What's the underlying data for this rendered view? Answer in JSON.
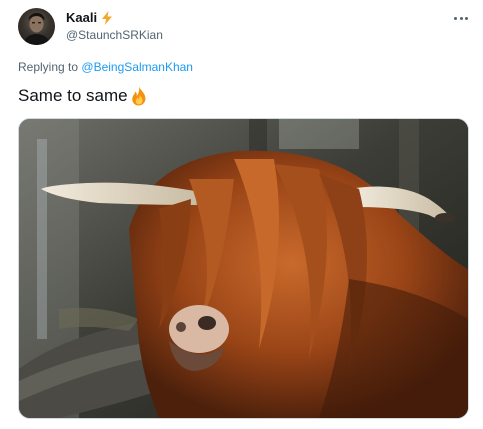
{
  "tweet": {
    "author": {
      "name": "Kaali",
      "handle": "@StaunchSRKian",
      "badge_icon": "lightning-bolt-icon",
      "badge_color": "#f5a623"
    },
    "reply": {
      "prefix": "Replying to",
      "target": "@BeingSalmanKhan",
      "link_color": "#1d9bf0"
    },
    "text": "Same to same",
    "emoji_icon": "fire-icon",
    "more_icon": "more-options-icon",
    "media": {
      "image_icon": "highland-cow-photo"
    }
  }
}
